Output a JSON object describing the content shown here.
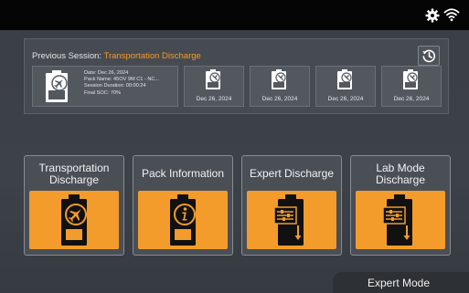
{
  "status_bar": {
    "icons": [
      "gear-icon",
      "wifi-icon"
    ]
  },
  "previous_session": {
    "title_prefix": "Previous Session: ",
    "session_name": "Transportation Discharge",
    "history_icon": "history-icon",
    "featured": {
      "date": "Date: Dec 26, 2024",
      "pack_name": "Pack Name: 45OV 9M C1 - NC...",
      "duration": "Session Duration: 00:00:24",
      "final_soc": "Final SOC: 70%"
    },
    "cards": [
      {
        "date": "Dec 26, 2024"
      },
      {
        "date": "Dec 26, 2024"
      },
      {
        "date": "Dec 26, 2024"
      },
      {
        "date": "Dec 26, 2024"
      }
    ]
  },
  "modes": [
    {
      "label": "Transportation Discharge",
      "icon": "battery-airplane-icon"
    },
    {
      "label": "Pack Information",
      "icon": "battery-info-icon"
    },
    {
      "label": "Expert Discharge",
      "icon": "battery-settings-discharge-icon"
    },
    {
      "label": "Lab Mode Discharge",
      "icon": "battery-lab-discharge-icon"
    }
  ],
  "footer": {
    "mode_label": "Expert Mode"
  },
  "colors": {
    "accent": "#f39c2b",
    "background": "#3c4147",
    "topbar": "#050505"
  }
}
